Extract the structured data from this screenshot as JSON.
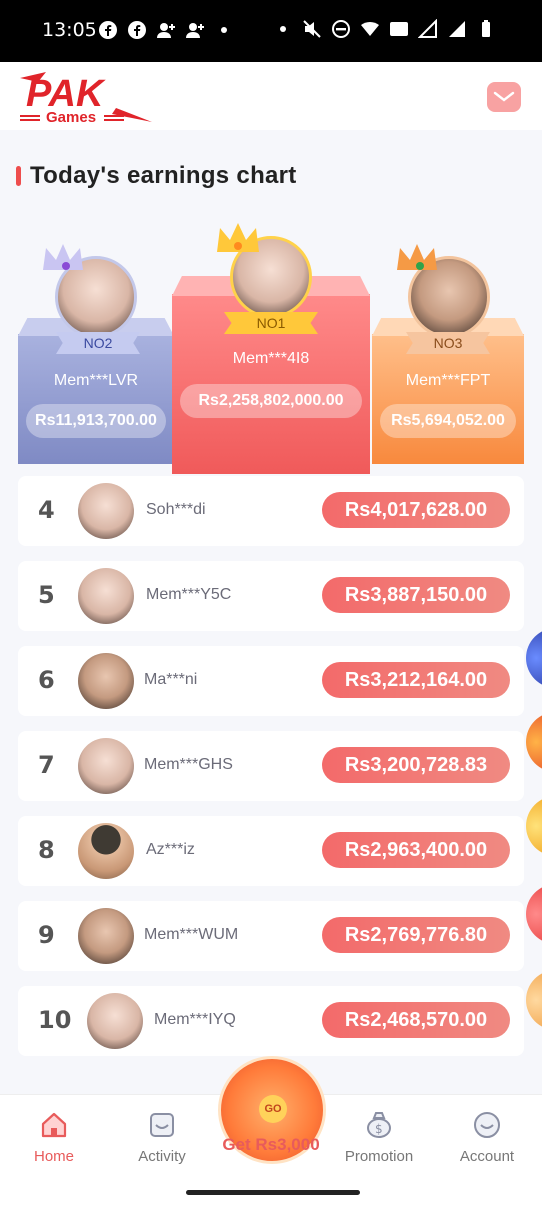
{
  "status_bar": {
    "time": "13:05"
  },
  "header": {
    "logo_text": "PAK",
    "logo_sub": "Games"
  },
  "section": {
    "title": "Today's earnings chart"
  },
  "podium": [
    {
      "rank_label": "NO2",
      "name": "Mem***LVR",
      "amount": "Rs11,913,700.00"
    },
    {
      "rank_label": "NO1",
      "name": "Mem***4I8",
      "amount": "Rs2,258,802,000.00"
    },
    {
      "rank_label": "NO3",
      "name": "Mem***FPT",
      "amount": "Rs5,694,052.00"
    }
  ],
  "rows": [
    {
      "rank": "4",
      "name": "Soh***di",
      "amount": "Rs4,017,628.00"
    },
    {
      "rank": "5",
      "name": "Mem***Y5C",
      "amount": "Rs3,887,150.00"
    },
    {
      "rank": "6",
      "name": "Ma***ni",
      "amount": "Rs3,212,164.00"
    },
    {
      "rank": "7",
      "name": "Mem***GHS",
      "amount": "Rs3,200,728.83"
    },
    {
      "rank": "8",
      "name": "Az***iz",
      "amount": "Rs2,963,400.00"
    },
    {
      "rank": "9",
      "name": "Mem***WUM",
      "amount": "Rs2,769,776.80"
    },
    {
      "rank": "10",
      "name": "Mem***IYQ",
      "amount": "Rs2,468,570.00"
    }
  ],
  "nav": {
    "home": "Home",
    "activity": "Activity",
    "center": "Get Rs3,000",
    "center_go": "GO",
    "promotion": "Promotion",
    "account": "Account"
  },
  "colors": {
    "accent": "#e85b5b",
    "first": "#f05a5a",
    "second": "#8b95cc",
    "third": "#f8893d"
  }
}
